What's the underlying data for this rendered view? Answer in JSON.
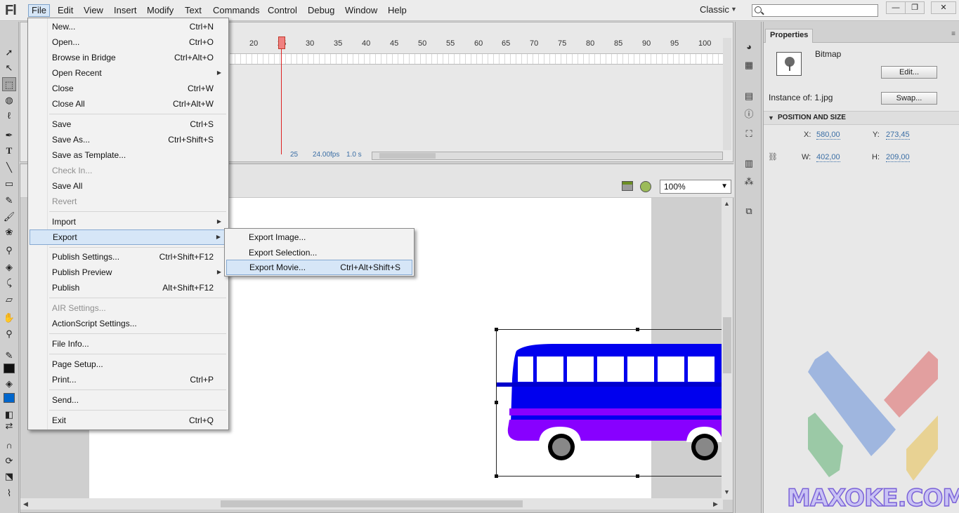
{
  "app": {
    "logo": "Fl"
  },
  "menubar": {
    "items": [
      {
        "label": "File",
        "active": true
      },
      {
        "label": "Edit"
      },
      {
        "label": "View"
      },
      {
        "label": "Insert"
      },
      {
        "label": "Modify"
      },
      {
        "label": "Text"
      },
      {
        "label": "Commands"
      },
      {
        "label": "Control"
      },
      {
        "label": "Debug"
      },
      {
        "label": "Window"
      },
      {
        "label": "Help"
      }
    ],
    "workspace": "Classic",
    "search_placeholder": ""
  },
  "window_controls": {
    "minimize": "—",
    "restore": "❐",
    "close": "✕"
  },
  "file_menu": [
    {
      "label": "New...",
      "shortcut": "Ctrl+N"
    },
    {
      "label": "Open...",
      "shortcut": "Ctrl+O"
    },
    {
      "label": "Browse in Bridge",
      "shortcut": "Ctrl+Alt+O"
    },
    {
      "label": "Open Recent",
      "shortcut": "",
      "submenu": true
    },
    {
      "label": "Close",
      "shortcut": "Ctrl+W"
    },
    {
      "label": "Close All",
      "shortcut": "Ctrl+Alt+W"
    },
    {
      "label": "Save",
      "shortcut": "Ctrl+S"
    },
    {
      "label": "Save As...",
      "shortcut": "Ctrl+Shift+S"
    },
    {
      "label": "Save as Template...",
      "shortcut": ""
    },
    {
      "label": "Check In...",
      "shortcut": "",
      "disabled": true
    },
    {
      "label": "Save All",
      "shortcut": ""
    },
    {
      "label": "Revert",
      "shortcut": "",
      "disabled": true
    },
    {
      "label": "Import",
      "shortcut": "",
      "submenu": true
    },
    {
      "label": "Export",
      "shortcut": "",
      "submenu": true,
      "highlighted": true
    },
    {
      "label": "Publish Settings...",
      "shortcut": "Ctrl+Shift+F12"
    },
    {
      "label": "Publish Preview",
      "shortcut": "",
      "submenu": true
    },
    {
      "label": "Publish",
      "shortcut": "Alt+Shift+F12"
    },
    {
      "label": "AIR Settings...",
      "shortcut": "",
      "disabled": true
    },
    {
      "label": "ActionScript Settings...",
      "shortcut": ""
    },
    {
      "label": "File Info...",
      "shortcut": ""
    },
    {
      "label": "Page Setup...",
      "shortcut": ""
    },
    {
      "label": "Print...",
      "shortcut": "Ctrl+P"
    },
    {
      "label": "Send...",
      "shortcut": ""
    },
    {
      "label": "Exit",
      "shortcut": "Ctrl+Q"
    }
  ],
  "export_menu": [
    {
      "label": "Export Image...",
      "shortcut": ""
    },
    {
      "label": "Export Selection...",
      "shortcut": ""
    },
    {
      "label": "Export Movie...",
      "shortcut": "Ctrl+Alt+Shift+S",
      "highlighted": true
    }
  ],
  "timeline": {
    "frame_numbers": [
      "20",
      "25",
      "30",
      "35",
      "40",
      "45",
      "50",
      "55",
      "60",
      "65",
      "70",
      "75",
      "80",
      "85",
      "90",
      "95",
      "100"
    ],
    "current_frame": "25",
    "fps": "24.00",
    "fps_unit": "fps",
    "time": "1.0 s"
  },
  "stage": {
    "zoom": "100%",
    "bus_colors": {
      "body": "#0000ee",
      "stripe": "#8800ff",
      "wheel": "#888888",
      "window": "#ffffff"
    }
  },
  "properties": {
    "tab": "Properties",
    "type": "Bitmap",
    "edit_button": "Edit...",
    "instance_label": "Instance of:",
    "instance_value": "1.jpg",
    "swap_button": "Swap...",
    "section_title": "POSITION AND SIZE",
    "x_label": "X:",
    "x_value": "580,00",
    "y_label": "Y:",
    "y_value": "273,45",
    "w_label": "W:",
    "w_value": "402,00",
    "h_label": "H:",
    "h_value": "209,00"
  },
  "watermark": {
    "text": "MAXOKE.COM"
  },
  "icons": {
    "toolbar": [
      "selection-tool-icon",
      "subselection-tool-icon",
      "free-transform-tool-icon",
      "3d-rotation-tool-icon",
      "lasso-tool-icon",
      "pen-tool-icon",
      "text-tool-icon",
      "line-tool-icon",
      "rectangle-tool-icon",
      "pencil-tool-icon",
      "brush-tool-icon",
      "deco-tool-icon",
      "bone-tool-icon",
      "paint-bucket-icon",
      "eyedropper-icon",
      "eraser-icon",
      "hand-tool-icon",
      "zoom-tool-icon"
    ],
    "strip": [
      "color-icon",
      "swatches-icon",
      "align-icon",
      "info-icon",
      "transform-icon",
      "library-icon",
      "motion-presets-icon",
      "components-icon"
    ]
  }
}
